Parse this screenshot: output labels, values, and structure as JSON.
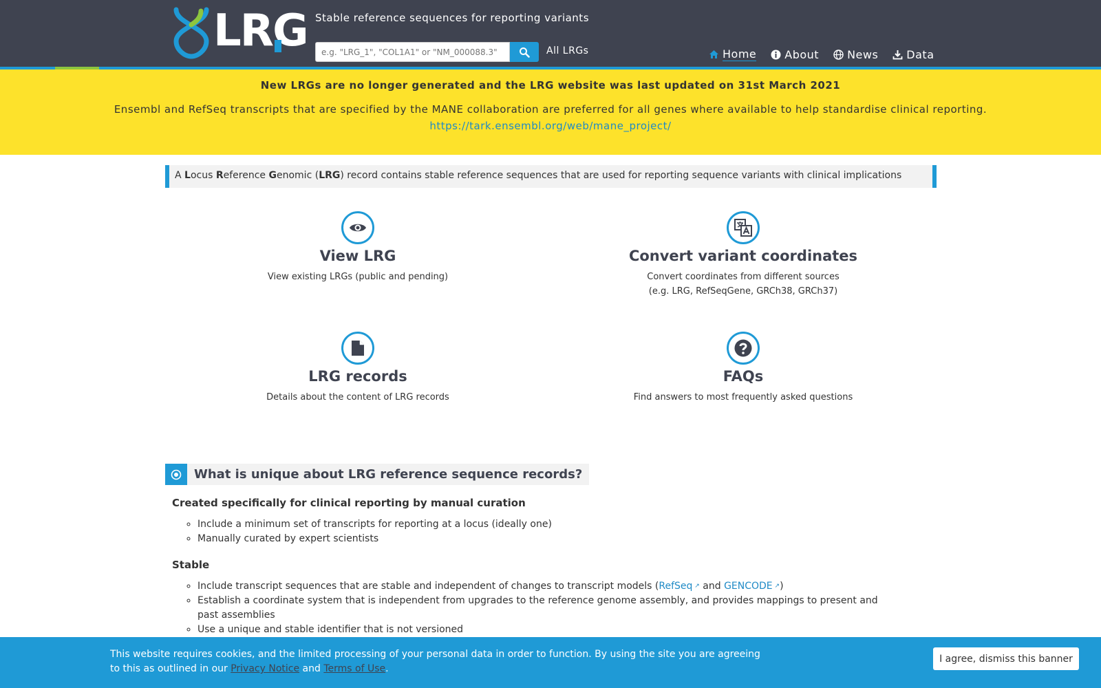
{
  "header": {
    "logo_text": "LRG",
    "tagline": "Stable reference sequences for reporting variants",
    "search_placeholder": "e.g. \"LRG_1\", \"COL1A1\" or \"NM_000088.3\"",
    "all_lrgs": "All LRGs",
    "nav": [
      {
        "label": "Home",
        "icon": "home-icon"
      },
      {
        "label": "About",
        "icon": "info-icon"
      },
      {
        "label": "News",
        "icon": "globe-icon"
      },
      {
        "label": "Data",
        "icon": "download-icon"
      }
    ]
  },
  "banner": {
    "title": "New LRGs are no longer generated and the LRG website was last updated on 31st March 2021",
    "text": "Ensembl and RefSeq transcripts that are specified by the MANE collaboration are preferred for all genes where available to help standardise clinical reporting.",
    "link": "https://tark.ensembl.org/web/mane_project/"
  },
  "intro": {
    "a": "A ",
    "l": "L",
    "locus": "ocus ",
    "r": "R",
    "eference": "eference ",
    "g": "G",
    "enomic": "enomic (",
    "lrg": "LRG",
    "rest": ") record contains stable reference sequences that are used for reporting sequence variants with clinical implications"
  },
  "cards": [
    {
      "title": "View LRG",
      "desc": "View existing LRGs (public and pending)",
      "icon": "eye-icon"
    },
    {
      "title": "Convert variant coordinates",
      "desc1": "Convert coordinates from different sources",
      "desc2": "(e.g. LRG, RefSeqGene, GRCh38, GRCh37)",
      "icon": "translate-icon"
    },
    {
      "title": "LRG records",
      "desc": "Details about the content of LRG records",
      "icon": "file-icon"
    },
    {
      "title": "FAQs",
      "desc": "Find answers to most frequently asked questions",
      "icon": "question-icon"
    }
  ],
  "unique": {
    "title": "What is unique about LRG reference sequence records?",
    "sections": [
      {
        "heading": "Created specifically for clinical reporting by manual curation",
        "items": [
          "Include a minimum set of transcripts for reporting at a locus (ideally one)",
          "Manually curated by expert scientists"
        ]
      },
      {
        "heading": "Stable",
        "item1_pre": "Include transcript sequences that are stable and independent of changes to transcript models (",
        "item1_refseq": "RefSeq",
        "item1_and": " and ",
        "item1_gencode": "GENCODE",
        "item1_post": ")",
        "item2": "Establish a coordinate system that is independent from upgrades to the reference genome assembly, and provides mappings to present and past assemblies",
        "item3": "Use a unique and stable identifier that is not versioned"
      }
    ]
  },
  "cookie": {
    "text": "This website requires cookies, and the limited processing of your personal data in order to function. By using the site you are agreeing to this as outlined in our ",
    "privacy": "Privacy Notice",
    "and": " and ",
    "terms": "Terms of Use",
    "end": ".",
    "button": "I agree, dismiss this banner"
  },
  "colors": {
    "header_bg": "#3f4350",
    "accent_blue": "#1f9ad6",
    "accent_green": "#8dc63f",
    "banner_yellow": "#fde22b"
  }
}
